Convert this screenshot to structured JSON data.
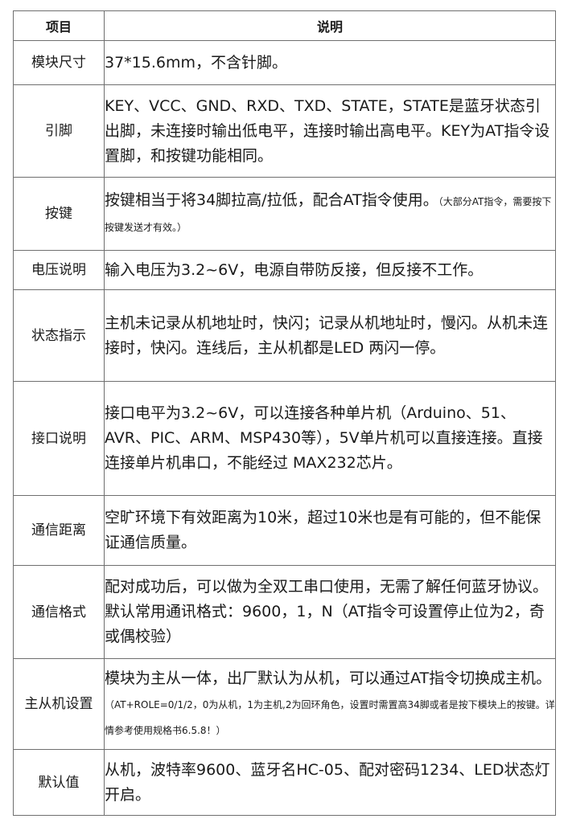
{
  "header": {
    "col1": "项目",
    "col2": "说明"
  },
  "rows": [
    {
      "label": "模块尺寸",
      "text": "37*15.6mm，不含针脚。",
      "note": ""
    },
    {
      "label": "引脚",
      "text": "KEY、VCC、GND、RXD、TXD、STATE，STATE是蓝牙状态引出脚，未连接时输出低电平，连接时输出高电平。KEY为AT指令设置脚，和按键功能相同。",
      "note": ""
    },
    {
      "label": "按键",
      "text": "按键相当于将34脚拉高/拉低，配合AT指令使用。",
      "note": "（大部分AT指令，需要按下按键发送才有效。）"
    },
    {
      "label": "电压说明",
      "text": "输入电压为3.2~6V，电源自带防反接，但反接不工作。",
      "note": ""
    },
    {
      "label": "状态指示",
      "text": "主机未记录从机地址时，快闪；记录从机地址时，慢闪。从机未连接时，快闪。连线后，主从机都是LED 两闪一停。",
      "note": ""
    },
    {
      "label": "接口说明",
      "text": "接口电平为3.2~6V，可以连接各种单片机（Arduino、51、AVR、PIC、ARM、MSP430等），5V单片机可以直接连接。直接连接单片机串口，不能经过 MAX232芯片。",
      "note": ""
    },
    {
      "label": "通信距离",
      "text": "空旷环境下有效距离为10米，超过10米也是有可能的，但不能保证通信质量。",
      "note": ""
    },
    {
      "label": "通信格式",
      "text": "配对成功后，可以做为全双工串口使用，无需了解任何蓝牙协议。默认常用通讯格式：9600，1，N（AT指令可设置停止位为2，奇或偶校验）",
      "note": ""
    },
    {
      "label": "主从机设置",
      "text": "模块为主从一体，出厂默认为从机，可以通过AT指令切换成主机。",
      "note": "（AT+ROLE=0/1/2，0为从机，1为主机,2为回环角色，设置时需置高34脚或者是按下模块上的按键。详情参考使用规格书6.5.8！）"
    },
    {
      "label": "默认值",
      "text": "从机，波特率9600、蓝牙名HC-05、配对密码1234、LED状态灯开启。",
      "note": ""
    }
  ]
}
